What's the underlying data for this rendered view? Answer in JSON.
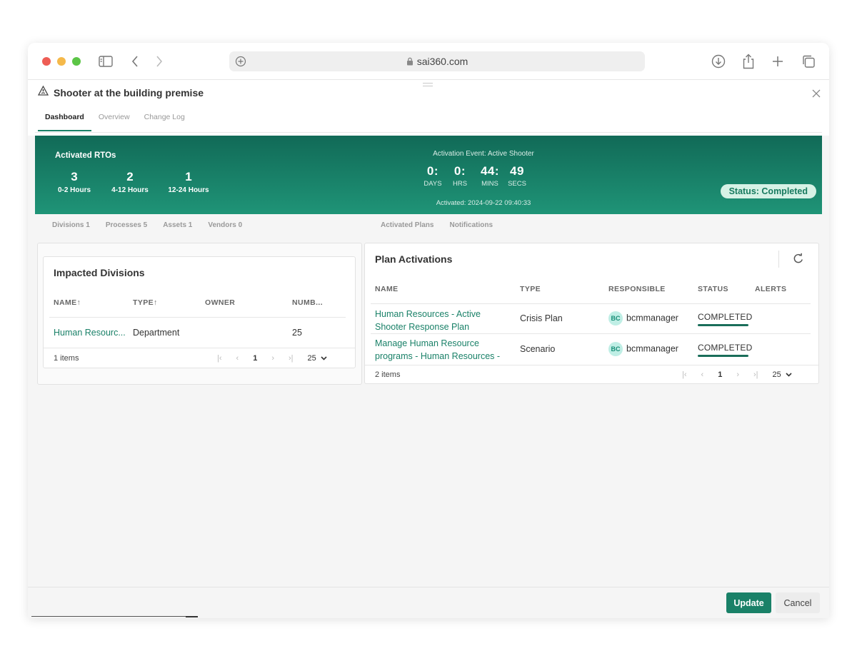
{
  "browser": {
    "url": "sai360.com"
  },
  "app": {
    "title": "Shooter at the building premise",
    "tabs": [
      "Dashboard",
      "Overview",
      "Change Log"
    ]
  },
  "banner": {
    "rto_title": "Activated RTOs",
    "rtos": [
      {
        "count": "3",
        "label": "0-2 Hours"
      },
      {
        "count": "2",
        "label": "4-12 Hours"
      },
      {
        "count": "1",
        "label": "12-24 Hours"
      }
    ],
    "event_label": "Activation Event: Active Shooter",
    "counter": {
      "days": "0",
      "hrs": "0",
      "mins": "44",
      "secs": "49",
      "days_label": "DAYS",
      "hrs_label": "HRS",
      "mins_label": "MINS",
      "secs_label": "SECS",
      "sep": ":"
    },
    "activated_at": "Activated: 2024-09-22 09:40:33",
    "status": "Status: Completed"
  },
  "subtabs_left": [
    "Divisions 1",
    "Processes 5",
    "Assets 1",
    "Vendors 0"
  ],
  "subtabs_right": [
    "Activated Plans",
    "Notifications"
  ],
  "impacted": {
    "title": "Impacted Divisions",
    "headers": {
      "name": "NAME",
      "type": "TYPE",
      "owner": "OWNER",
      "number": "NUMB..."
    },
    "sort_arrow": "↑",
    "rows": [
      {
        "name": "Human Resourc...",
        "type": "Department",
        "owner": "",
        "number": "25"
      }
    ],
    "count": "1 items",
    "page": "1",
    "page_size": "25"
  },
  "plans": {
    "title": "Plan Activations",
    "headers": {
      "name": "NAME",
      "type": "TYPE",
      "responsible": "RESPONSIBLE",
      "status": "STATUS",
      "alerts": "ALERTS"
    },
    "rows": [
      {
        "name_line1": "Human Resources - Active",
        "name_line2": "Shooter Response Plan",
        "type": "Crisis Plan",
        "initials": "BC",
        "responsible": "bcmmanager",
        "status": "COMPLETED"
      },
      {
        "name_line1": "Manage Human Resource",
        "name_line2": "programs - Human Resources -",
        "type": "Scenario",
        "initials": "BC",
        "responsible": "bcmmanager",
        "status": "COMPLETED"
      }
    ],
    "count": "2 items",
    "page": "1",
    "page_size": "25"
  },
  "footer": {
    "update": "Update",
    "cancel": "Cancel"
  }
}
